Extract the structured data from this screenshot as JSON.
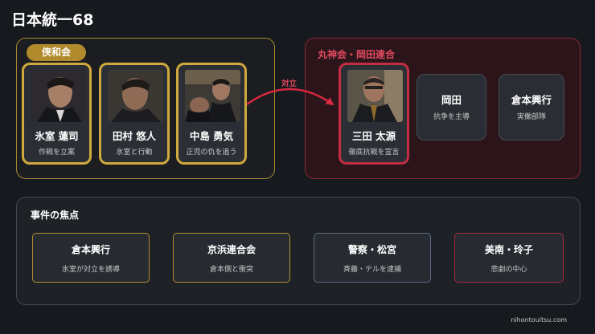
{
  "title": "日本統一68",
  "factions": {
    "left": {
      "label": "侠和会",
      "members": [
        {
          "name": "氷室 蓮司",
          "role": "作戦を立案"
        },
        {
          "name": "田村 悠人",
          "role": "氷室と行動"
        },
        {
          "name": "中島 勇気",
          "role": "正児の仇を追う"
        }
      ]
    },
    "right": {
      "label": "丸神会・岡田連合",
      "leader": {
        "name": "三田 太源",
        "role": "徹底抗戦を宣言"
      },
      "others": [
        {
          "name": "岡田",
          "role": "抗争を主導"
        },
        {
          "name": "倉本興行",
          "role": "実働部隊"
        }
      ]
    }
  },
  "relation_label": "対立",
  "events": {
    "title": "事件の焦点",
    "items": [
      {
        "name": "倉本興行",
        "desc": "氷室が対立を誘導"
      },
      {
        "name": "京浜連合会",
        "desc": "倉本側と衝突"
      },
      {
        "name": "警察・松宮",
        "desc": "斉藤・テルを逮捕"
      },
      {
        "name": "美南・玲子",
        "desc": "悲劇の中心"
      }
    ]
  },
  "footer": "nihontouitsu.com",
  "colors": {
    "gold": "#cfa93d",
    "red": "#c22d43",
    "relation": "#d7283f"
  }
}
